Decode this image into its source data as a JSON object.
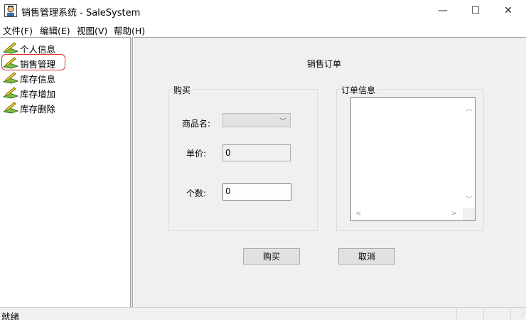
{
  "window": {
    "title": "销售管理系统 - SaleSystem",
    "minimize": "—",
    "maximize": "☐",
    "close": "✕"
  },
  "menu": {
    "items": [
      "文件(F)",
      "编辑(E)",
      "视图(V)",
      "帮助(H)"
    ]
  },
  "tree": {
    "items": [
      "个人信息",
      "销售管理",
      "库存信息",
      "库存增加",
      "库存删除"
    ],
    "selected": "销售管理"
  },
  "form": {
    "title": "销售订单",
    "purchase_group": "购买",
    "order_group": "订单信息",
    "product_label": "商品名:",
    "product_value": "",
    "price_label": "单价:",
    "price_value": "0",
    "count_label": "个数:",
    "count_value": "0",
    "buy_button": "购买",
    "cancel_button": "取消"
  },
  "status": {
    "text": "就绪"
  },
  "colors": {
    "selection_ring": "#d9322b",
    "view_background": "#f0f0f0"
  }
}
